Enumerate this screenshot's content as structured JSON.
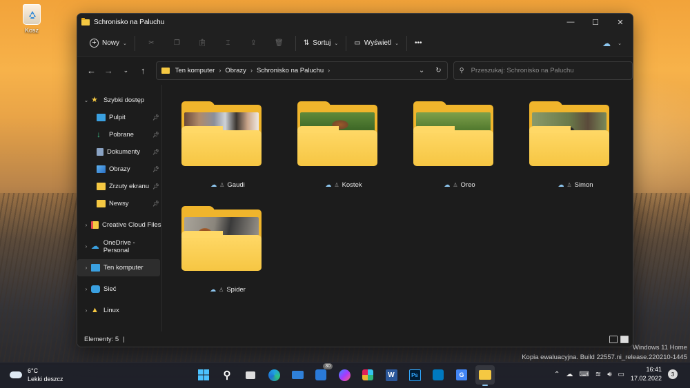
{
  "desktop": {
    "recycle_bin_label": "Kosz"
  },
  "window": {
    "title": "Schronisko na Paluchu",
    "controls": {
      "minimize": "—",
      "maximize": "☐",
      "close": "✕"
    }
  },
  "toolbar": {
    "new_label": "Nowy",
    "sort_label": "Sortuj",
    "view_label": "Wyświetl",
    "more_label": "•••"
  },
  "address": {
    "crumbs": [
      "Ten komputer",
      "Obrazy",
      "Schronisko na Paluchu"
    ],
    "search_placeholder": "Przeszukaj: Schronisko na Paluchu"
  },
  "sidebar": {
    "quick_access": "Szybki dostęp",
    "quick_items": [
      "Pulpit",
      "Pobrane",
      "Dokumenty",
      "Obrazy",
      "Zrzuty ekranu",
      "Newsy"
    ],
    "roots": [
      "Creative Cloud Files",
      "OneDrive - Personal",
      "Ten komputer",
      "Sieć",
      "Linux"
    ]
  },
  "folders": [
    {
      "name": "Gaudi"
    },
    {
      "name": "Kostek"
    },
    {
      "name": "Oreo"
    },
    {
      "name": "Simon"
    },
    {
      "name": "Spider"
    }
  ],
  "status": {
    "items_text": "Elementy: 5"
  },
  "watermark": {
    "line1": "Windows 11 Home",
    "line2": "Kopia ewaluacyjna. Build 22557.ni_release.220210-1445"
  },
  "taskbar": {
    "weather_temp": "6°C",
    "weather_desc": "Lekki deszcz",
    "teams_badge": "30",
    "time": "16:41",
    "date": "17.02.2022",
    "notifications": "3"
  },
  "colors": {
    "folder": "#f6c643",
    "accent": "#8ec7f0",
    "window_bg": "#1c1c1c"
  }
}
